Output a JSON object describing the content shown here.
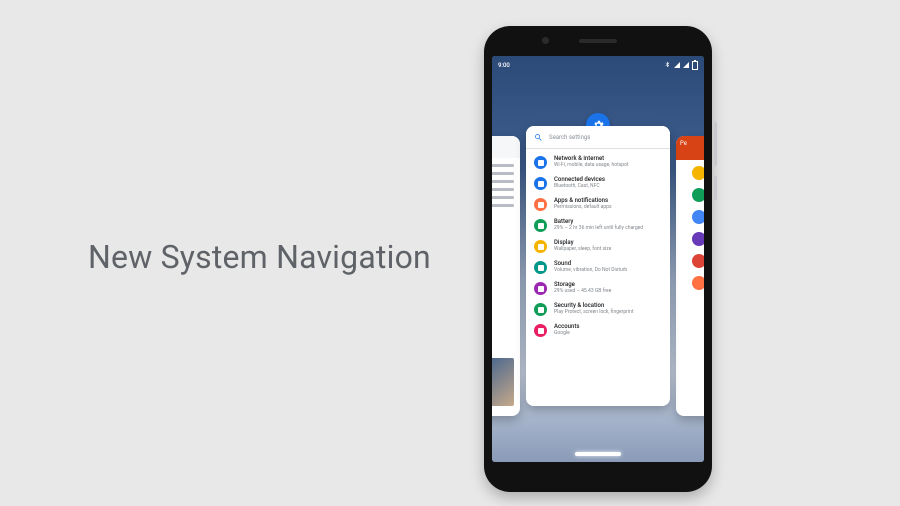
{
  "headline": "New System Navigation",
  "status": {
    "time": "9:00"
  },
  "search": {
    "placeholder": "Search settings"
  },
  "settings_app_icon": "gear-icon",
  "right_card_label": "Pe",
  "settings": [
    {
      "icon": "#1a73e8",
      "title": "Network & internet",
      "sub": "Wi-Fi, mobile, data usage, hotspot"
    },
    {
      "icon": "#1a73e8",
      "title": "Connected devices",
      "sub": "Bluetooth, Cast, NFC"
    },
    {
      "icon": "#ff7043",
      "title": "Apps & notifications",
      "sub": "Permissions, default apps"
    },
    {
      "icon": "#0f9d58",
      "title": "Battery",
      "sub": "29% – 2 hr 36 min left until fully charged"
    },
    {
      "icon": "#f4b400",
      "title": "Display",
      "sub": "Wallpaper, sleep, font size"
    },
    {
      "icon": "#009688",
      "title": "Sound",
      "sub": "Volume, vibration, Do Not Disturb"
    },
    {
      "icon": "#9c27b0",
      "title": "Storage",
      "sub": "29% used – 45.43 GB free"
    },
    {
      "icon": "#0f9d58",
      "title": "Security & location",
      "sub": "Play Protect, screen lock, fingerprint"
    },
    {
      "icon": "#e91e63",
      "title": "Accounts",
      "sub": "Google"
    }
  ]
}
